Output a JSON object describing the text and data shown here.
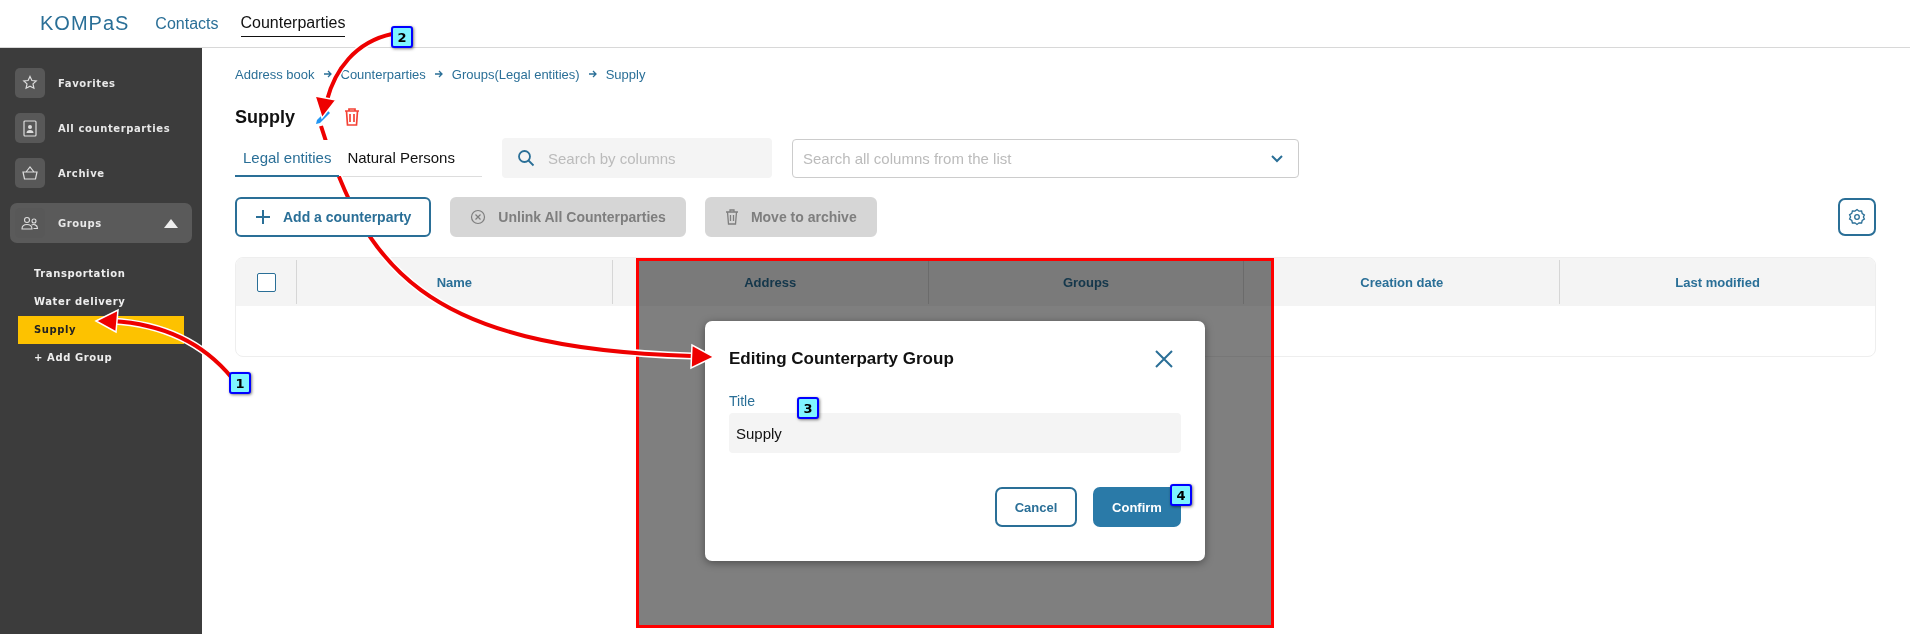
{
  "header": {
    "logo": "KOMPaS",
    "nav": [
      {
        "label": "Contacts",
        "selected": false
      },
      {
        "label": "Counterparties",
        "selected": true
      }
    ]
  },
  "sidebar": {
    "items": [
      {
        "label": "Favorites",
        "kind": "star",
        "expanded": false
      },
      {
        "label": "All counterparties",
        "kind": "contact",
        "expanded": false
      },
      {
        "label": "Archive",
        "kind": "basket",
        "expanded": false
      },
      {
        "label": "Groups",
        "kind": "people",
        "expanded": true
      }
    ],
    "groups": [
      {
        "label": "Transportation",
        "selected": false
      },
      {
        "label": "Water delivery",
        "selected": false
      },
      {
        "label": "Supply",
        "selected": true
      }
    ],
    "add_group": "+ Add Group"
  },
  "breadcrumb": [
    "Address book",
    "Counterparties",
    "Groups(Legal entities)",
    "Supply"
  ],
  "page_title": "Supply",
  "tabs": [
    {
      "label": "Legal entities",
      "selected": true
    },
    {
      "label": "Natural Persons",
      "selected": false
    }
  ],
  "column_search": {
    "placeholder": "Search by columns"
  },
  "list_search": {
    "placeholder": "Search all columns from the list"
  },
  "buttons": [
    {
      "label": "Add a counterparty",
      "kind": "plus",
      "disabled": false
    },
    {
      "label": "Unlink All Counterparties",
      "kind": "unlink",
      "disabled": true
    },
    {
      "label": "Move to archive",
      "kind": "trash",
      "disabled": true
    }
  ],
  "table": {
    "select_all": {
      "checked": false
    },
    "columns": [
      "Name",
      "Address",
      "Groups",
      "Creation date",
      "Last modified"
    ]
  },
  "dialog": {
    "title": "Editing Counterparty Group",
    "field_label": "Title",
    "field_value": "Supply",
    "buttons": [
      {
        "label": "Cancel",
        "kind": "secondary"
      },
      {
        "label": "Confirm",
        "kind": "primary"
      }
    ]
  },
  "annotations": [
    "1",
    "2",
    "3",
    "4"
  ]
}
